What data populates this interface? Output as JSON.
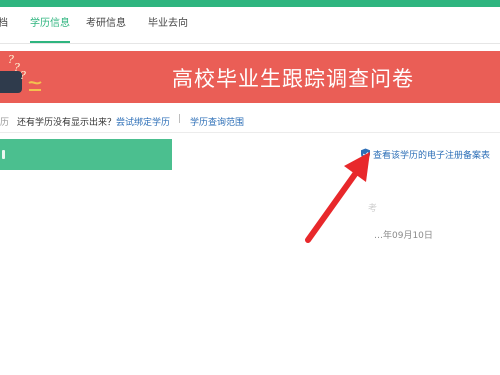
{
  "nav": {
    "items": [
      {
        "label": "档"
      },
      {
        "label": "学历信息",
        "active": true
      },
      {
        "label": "考研信息"
      },
      {
        "label": "毕业去向"
      }
    ]
  },
  "banner": {
    "title": "高校毕业生跟踪调查问卷",
    "color": "#ea5e56"
  },
  "info": {
    "cut_text": "历",
    "question": "还有学历没有显示出来？",
    "link_bind": "尝试绑定学历",
    "separator": "|",
    "link_scope": "学历查询范围"
  },
  "section": {
    "bar_color": "#4bbf8f"
  },
  "record": {
    "e_registration_link": "查看该学历的电子注册备案表",
    "link_icon": "shield-icon",
    "faint_text": "考",
    "date_text": "…年09月10日"
  },
  "annotation": {
    "arrow_color": "#e8282b"
  },
  "theme": {
    "accent": "#2fb57f",
    "link": "#2d6fb7"
  }
}
